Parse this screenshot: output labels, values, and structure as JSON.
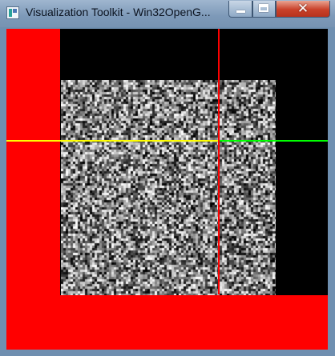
{
  "window": {
    "title": "Visualization Toolkit - Win32OpenG...",
    "icon": "vtk-app-icon",
    "buttons": [
      "minimize-icon",
      "maximize-icon",
      "close-icon"
    ]
  },
  "render": {
    "background": "#000000",
    "accent_red": "#ff0000",
    "horizontal_line_colors": [
      "#ffff00",
      "#00ff00"
    ],
    "vertical_line_color": "#ff0000",
    "image_content": "random grayscale noise"
  }
}
